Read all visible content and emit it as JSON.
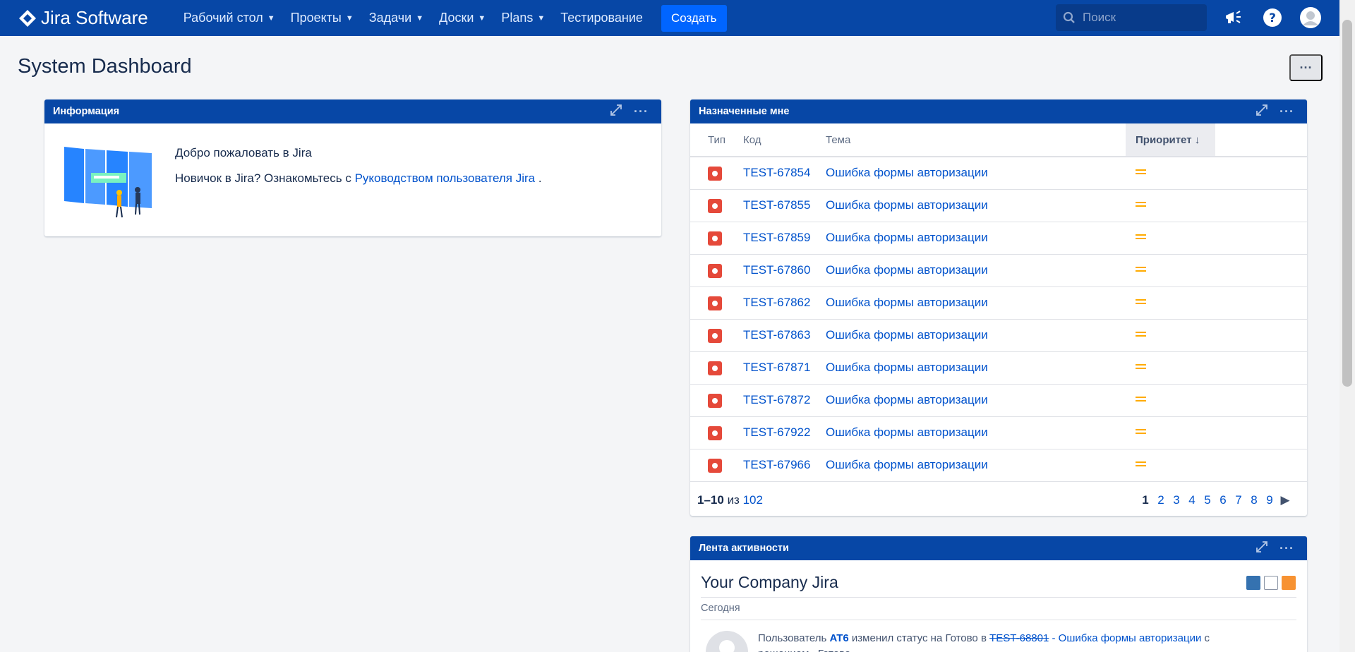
{
  "nav": {
    "logo": "Jira Software",
    "items": [
      {
        "label": "Рабочий стол",
        "has_dropdown": true
      },
      {
        "label": "Проекты",
        "has_dropdown": true
      },
      {
        "label": "Задачи",
        "has_dropdown": true
      },
      {
        "label": "Доски",
        "has_dropdown": true
      },
      {
        "label": "Plans",
        "has_dropdown": true
      },
      {
        "label": "Тестирование",
        "has_dropdown": false
      }
    ],
    "create_label": "Создать",
    "search_placeholder": "Поиск"
  },
  "page": {
    "title": "System Dashboard",
    "more_label": "···"
  },
  "info_gadget": {
    "title": "Информация",
    "welcome": "Добро пожаловать в Jira",
    "newbie_prefix": "Новичок в Jira? Ознакомьтесь с",
    "guide_link": "Руководством пользователя Jira",
    "newbie_suffix": "."
  },
  "assigned_gadget": {
    "title": "Назначенные мне",
    "columns": {
      "type": "Тип",
      "key": "Код",
      "summary": "Тема",
      "priority": "Приоритет"
    },
    "rows": [
      {
        "key": "TEST-67854",
        "summary": "Ошибка формы авторизации"
      },
      {
        "key": "TEST-67855",
        "summary": "Ошибка формы авторизации"
      },
      {
        "key": "TEST-67859",
        "summary": "Ошибка формы авторизации"
      },
      {
        "key": "TEST-67860",
        "summary": "Ошибка формы авторизации"
      },
      {
        "key": "TEST-67862",
        "summary": "Ошибка формы авторизации"
      },
      {
        "key": "TEST-67863",
        "summary": "Ошибка формы авторизации"
      },
      {
        "key": "TEST-67871",
        "summary": "Ошибка формы авторизации"
      },
      {
        "key": "TEST-67872",
        "summary": "Ошибка формы авторизации"
      },
      {
        "key": "TEST-67922",
        "summary": "Ошибка формы авторизации"
      },
      {
        "key": "TEST-67966",
        "summary": "Ошибка формы авторизации"
      }
    ],
    "pager": {
      "range": "1–10",
      "of": "из",
      "total": "102",
      "pages": [
        "1",
        "2",
        "3",
        "4",
        "5",
        "6",
        "7",
        "8",
        "9"
      ]
    }
  },
  "activity_gadget": {
    "title": "Лента активности",
    "stream_title": "Your Company Jira",
    "today": "Сегодня",
    "entry": {
      "prefix": "Пользователь",
      "user": "AT6",
      "action": "изменил статус на Готово в",
      "issue_key": "TEST-68801",
      "issue_summary": "- Ошибка формы авторизации",
      "suffix": "с решением «Готово»."
    }
  },
  "colors": {
    "nav_bg": "#0747a6",
    "create_btn": "#0065ff",
    "link": "#0052cc",
    "bug": "#e5493a",
    "priority_medium": "#ffab00"
  }
}
